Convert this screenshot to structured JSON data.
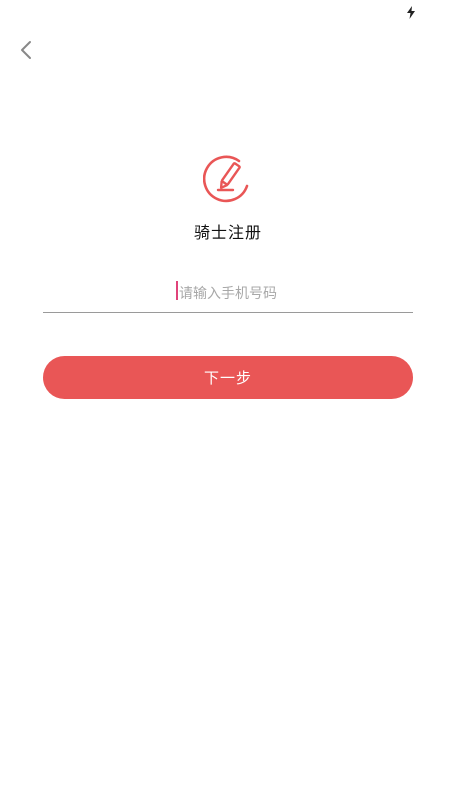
{
  "status_bar": {
    "icons": [
      "charging-icon"
    ]
  },
  "header": {
    "back_icon": "chevron-left-icon"
  },
  "brand": {
    "logo_icon": "pencil-circle-icon",
    "accent_color": "#e95656"
  },
  "page": {
    "title": "骑士注册"
  },
  "form": {
    "phone_value": "",
    "phone_placeholder": "请输入手机号码"
  },
  "actions": {
    "next_label": "下一步"
  }
}
